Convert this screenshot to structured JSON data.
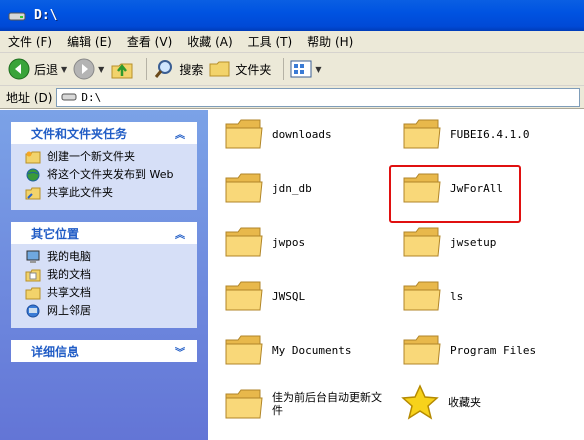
{
  "window": {
    "title": "D:\\"
  },
  "menu": [
    "文件 (F)",
    "编辑 (E)",
    "查看 (V)",
    "收藏 (A)",
    "工具 (T)",
    "帮助 (H)"
  ],
  "toolbar": {
    "back": "后退",
    "search": "搜索",
    "folders": "文件夹"
  },
  "address": {
    "label": "地址 (D)",
    "value": "D:\\"
  },
  "tasks": {
    "header": "文件和文件夹任务",
    "items": [
      "创建一个新文件夹",
      "将这个文件夹发布到 Web",
      "共享此文件夹"
    ]
  },
  "places": {
    "header": "其它位置",
    "items": [
      "我的电脑",
      "我的文档",
      "共享文档",
      "网上邻居"
    ]
  },
  "details": {
    "header": "详细信息"
  },
  "items": [
    "downloads",
    "FUBEI6.4.1.0",
    "jdn_db",
    "JwForAll",
    "jwpos",
    "jwsetup",
    "JWSQL",
    "ls",
    "My Documents",
    "Program Files",
    "佳为前后台自动更新文件",
    "收藏夹"
  ],
  "colors": {
    "title": "#0053e1",
    "panel": "#7ba2e7",
    "highlight": "#e01010"
  }
}
